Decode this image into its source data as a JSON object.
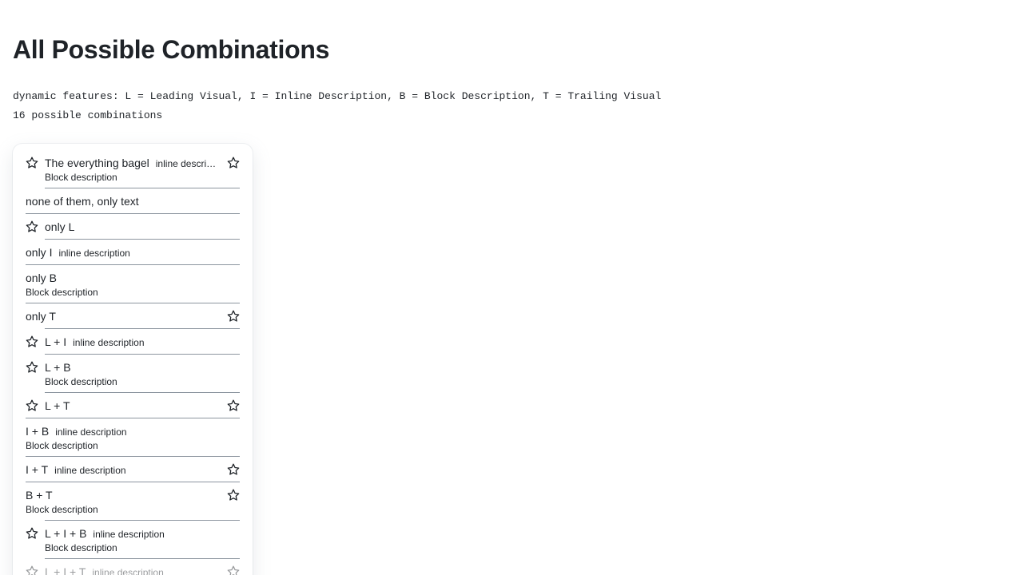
{
  "page": {
    "title": "All Possible Combinations",
    "features_line": "dynamic features: L = Leading Visual, I = Inline Description, B = Block Description, T = Trailing Visual",
    "count_line": "16 possible combinations"
  },
  "icons": {
    "leading": "star-icon",
    "trailing": "star-icon"
  },
  "items": [
    {
      "label": "The everything bagel",
      "inline": "inline description",
      "block": "Block description"
    },
    {
      "label": "none of them, only text"
    },
    {
      "label": "only L"
    },
    {
      "label": "only I",
      "inline": "inline description"
    },
    {
      "label": "only B",
      "block": "Block description"
    },
    {
      "label": "only T"
    },
    {
      "label": "L + I",
      "inline": "inline description"
    },
    {
      "label": "L + B",
      "block": "Block description"
    },
    {
      "label": "L + T"
    },
    {
      "label": "I + B",
      "inline": "inline description",
      "block": "Block description"
    },
    {
      "label": "I + T",
      "inline": "inline description"
    },
    {
      "label": "B + T",
      "block": "Block description"
    },
    {
      "label": "L + I + B",
      "inline": "inline description",
      "block": "Block description"
    },
    {
      "label": "L + I + T",
      "inline": "inline description"
    }
  ]
}
